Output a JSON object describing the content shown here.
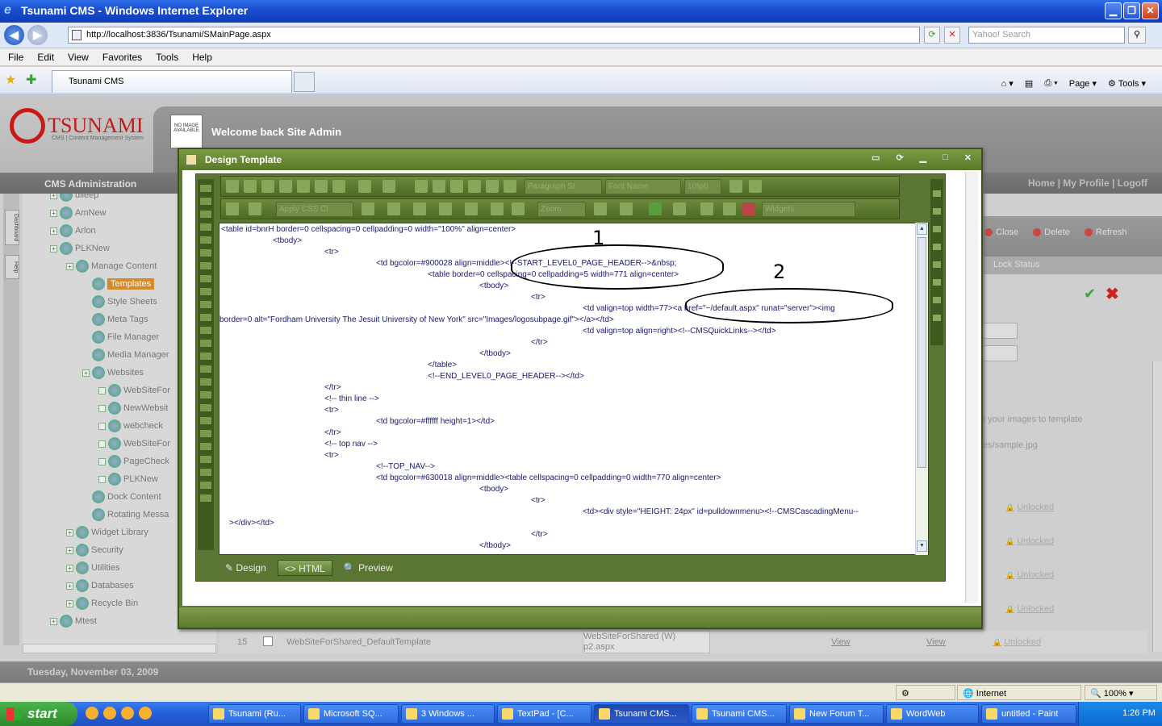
{
  "window": {
    "title": "Tsunami CMS - Windows Internet Explorer"
  },
  "browser": {
    "url": "http://localhost:3836/Tsunami/SMainPage.aspx",
    "search_placeholder": "Yahoo! Search",
    "menu": [
      "File",
      "Edit",
      "View",
      "Favorites",
      "Tools",
      "Help"
    ],
    "tab_title": "Tsunami CMS",
    "commands": {
      "page": "Page",
      "tools": "Tools"
    }
  },
  "site": {
    "logo": "TSUNAMI",
    "logo_sub": "CMS | Content Management System",
    "no_image": "NO IMAGE AVAILABLE",
    "welcome": "Welcome back Site Admin",
    "cms_admin": "CMS Administration",
    "top_links": "Home | My Profile | Logoff",
    "left_tabs": [
      "Dashboard",
      "Help"
    ],
    "date": "Tuesday, November 03, 2009"
  },
  "tree": [
    {
      "label": "dileep",
      "level": 1
    },
    {
      "label": "AmNew",
      "level": 1
    },
    {
      "label": "Arlon",
      "level": 1
    },
    {
      "label": "PLKNew",
      "level": 1
    },
    {
      "label": "Manage Content",
      "level": 2
    },
    {
      "label": "Templates",
      "level": 3,
      "selected": true
    },
    {
      "label": "Style Sheets",
      "level": 3
    },
    {
      "label": "Meta Tags",
      "level": 3
    },
    {
      "label": "File Manager",
      "level": 3
    },
    {
      "label": "Media Manager",
      "level": 3
    },
    {
      "label": "Websites",
      "level": 3
    },
    {
      "label": "WebSiteFor",
      "level": 4
    },
    {
      "label": "NewWebsit",
      "level": 4
    },
    {
      "label": "webcheck",
      "level": 4
    },
    {
      "label": "WebSiteFor",
      "level": 4
    },
    {
      "label": "PageCheck",
      "level": 4
    },
    {
      "label": "PLKNew",
      "level": 4
    },
    {
      "label": "Dock Content",
      "level": 3
    },
    {
      "label": "Rotating Messa",
      "level": 3
    },
    {
      "label": "Widget Library",
      "level": 2
    },
    {
      "label": "Security",
      "level": 2
    },
    {
      "label": "Utilities",
      "level": 2
    },
    {
      "label": "Databases",
      "level": 2
    },
    {
      "label": "Recycle Bin",
      "level": 2
    },
    {
      "label": "Mtest",
      "level": 1
    }
  ],
  "right_panel": {
    "actions": [
      "Close",
      "Delete",
      "Refresh"
    ],
    "lock_status": "Lock Status",
    "hint_text": "d your images to template",
    "hint_path": "/es/sample.jpg",
    "unlocked_links": [
      "Unlocked",
      "Unlocked",
      "Unlocked",
      "Unlocked",
      "Unlocked"
    ]
  },
  "grid_row": {
    "num": "15",
    "name": "WebSiteForShared_DefaultTemplate",
    "site": "WebSiteForShared (W)",
    "page": "p2.aspx",
    "view1": "View",
    "view2": "View",
    "lock": "Unlocked"
  },
  "dialog": {
    "title": "Design Template",
    "toolbar": {
      "paragraph_style": "Paragraph St",
      "font_name": "Font Name",
      "font_size": "1(8pt)",
      "css_class": "Apply CSS Cl",
      "zoom": "Zoom",
      "widgets": "Widgets"
    },
    "modes": [
      "Design",
      "HTML",
      "Preview"
    ],
    "code_lines": [
      "<table id=bnrH border=0 cellspacing=0 cellpadding=0 width=\"100%\" align=center>",
      "<tbody>",
      "<tr>",
      "<td bgcolor=#900028 align=middle><!--START_LEVEL0_PAGE_HEADER-->&nbsp;",
      "<table border=0 cellspacing=0 cellpadding=5 width=771 align=center>",
      "<tbody>",
      "<tr>",
      "<td valign=top width=77><a href=\"~/default.aspx\" runat=\"server\"><img",
      "border=0 alt=\"Fordham University The Jesuit University of New York\" src=\"Images/logosubpage.gif\"></a></td>",
      "<td valign=top align=right><!--CMSQuickLinks--></td>",
      "</tr>",
      "</tbody>",
      "</table>",
      "<!--END_LEVEL0_PAGE_HEADER--></td>",
      "</tr>",
      "<!-- thin line -->",
      "<tr>",
      "<td bgcolor=#ffffff height=1></td>",
      "</tr>",
      "<!-- top nav -->",
      "<tr>",
      "<!--TOP_NAV-->",
      "<td bgcolor=#630018 align=middle><table cellspacing=0 cellpadding=0 width=770 align=center>",
      "<tbody>",
      "<tr>",
      "<td><div style=\"HEIGHT: 24px\" id=pulldownmenu><!--CMSCascadingMenu--",
      "></div></td>",
      "</tr>",
      "</tbody>"
    ],
    "annotations": [
      "1",
      "2"
    ]
  },
  "statusbar": {
    "zone": "Internet",
    "zoom": "100%"
  },
  "taskbar": {
    "start": "start",
    "tasks": [
      "Tsunami (Ru...",
      "Microsoft SQ...",
      "3 Windows ...",
      "TextPad - [C...",
      "Tsunami CMS...",
      "Tsunami CMS...",
      "New Forum T...",
      "WordWeb",
      "untitled - Paint"
    ],
    "time": "1:26 PM"
  },
  "colors": {
    "xp_blue": "#245ed8",
    "dialog_green": "#5e7a38",
    "tsunami_red": "#c81818"
  }
}
